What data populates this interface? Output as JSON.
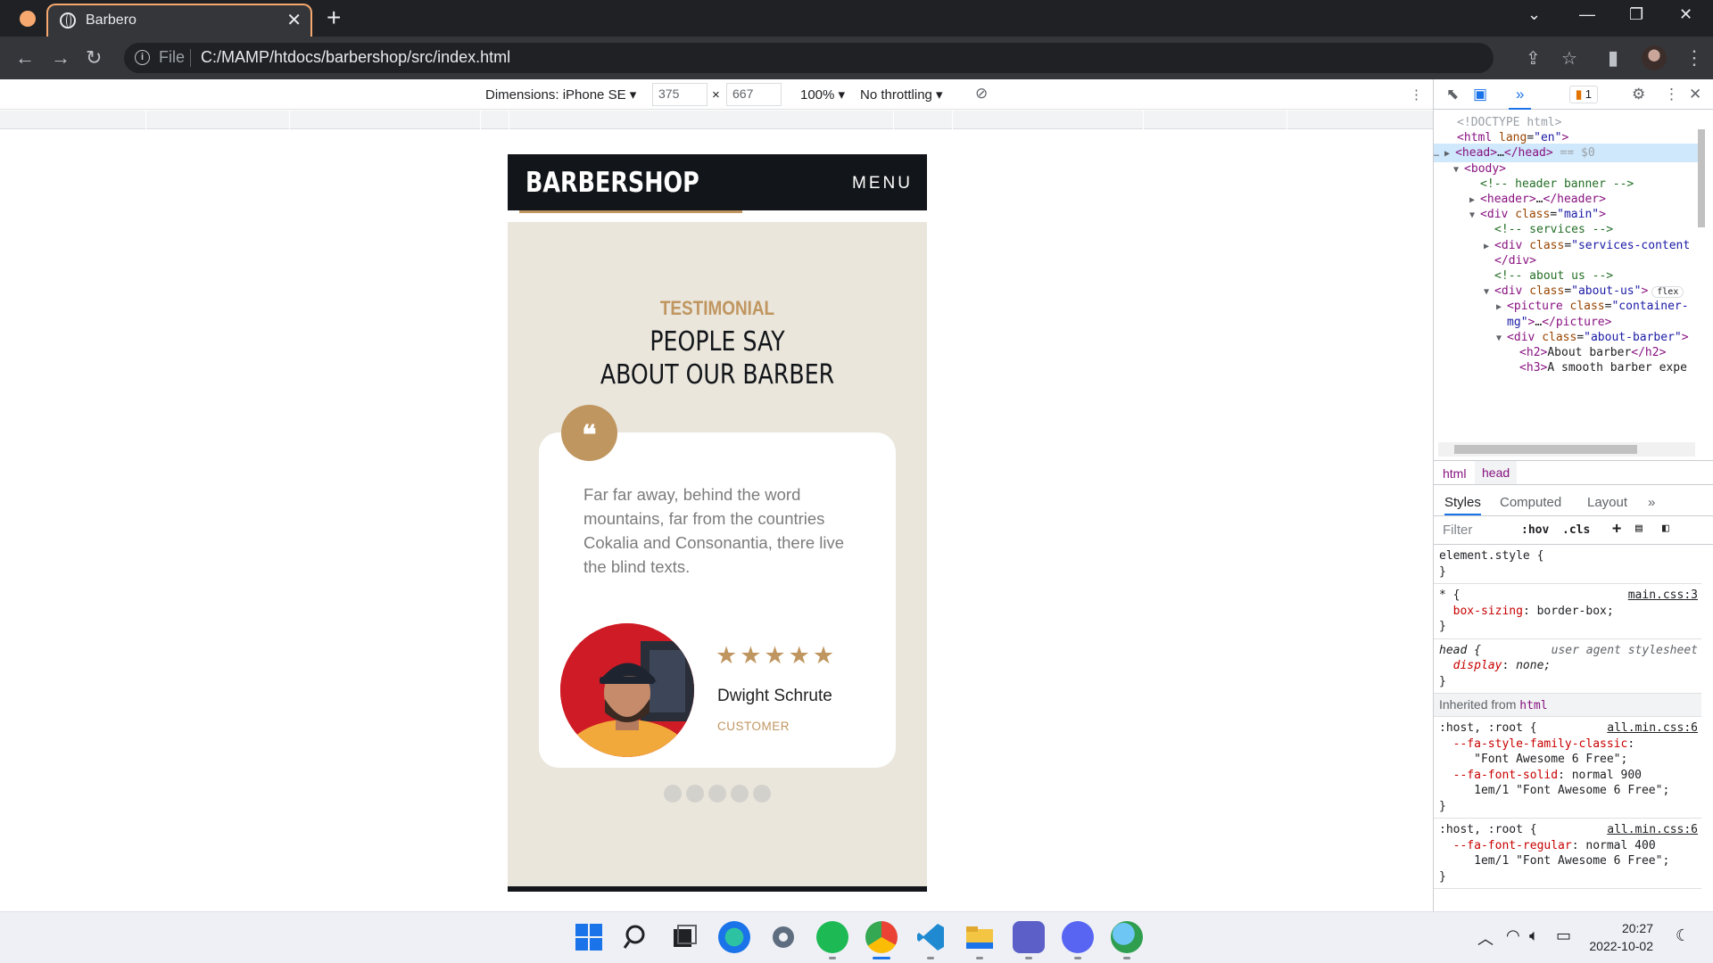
{
  "browser": {
    "tab_title": "Barbero",
    "file_label": "File",
    "url": "C:/MAMP/htdocs/barbershop/src/index.html"
  },
  "device_toolbar": {
    "dimensions_label": "Dimensions: iPhone SE",
    "width": "375",
    "times": "×",
    "height": "667",
    "zoom": "100%",
    "throttling": "No throttling"
  },
  "site": {
    "logo": "BARBERSHOP",
    "menu": "MENU",
    "eyebrow": "TESTIMONIAL",
    "heading_line1": "PEOPLE SAY",
    "heading_line2": "ABOUT OUR BARBER",
    "quote_mark": "❝",
    "quote": "Far far away, behind the word mountains, far from the countries Cokalia and Consonantia, there live the blind texts.",
    "stars": "★★★★★",
    "rating": 5,
    "customer_name": "Dwight Schrute",
    "customer_role": "CUSTOMER",
    "dots": 5
  },
  "devtools": {
    "warning_count": "1",
    "elements": [
      {
        "html": "<span class='gray'>&lt;!DOCTYPE html&gt;</span>"
      },
      {
        "html": "<span class='tag'>&lt;html</span> <span class='attr'>lang</span>=<span class='val'>\"en\"</span><span class='tag'>&gt;</span>"
      },
      {
        "html": "<span class='tag'>&lt;head&gt;</span>…<span class='tag'>&lt;/head&gt;</span> <span class='gray'>== $0</span>"
      },
      {
        "html": "<span class='tag'>&lt;body&gt;</span>"
      },
      {
        "html": "<span class='cmt'>&lt;!-- header banner --&gt;</span>"
      },
      {
        "html": "<span class='tag'>&lt;header&gt;</span>…<span class='tag'>&lt;/header&gt;</span>"
      },
      {
        "html": "<span class='tag'>&lt;div</span> <span class='attr'>class</span>=<span class='val'>\"main\"</span><span class='tag'>&gt;</span>"
      },
      {
        "html": "<span class='cmt'>&lt;!-- services --&gt;</span>"
      },
      {
        "html": "<span class='tag'>&lt;div</span> <span class='attr'>class</span>=<span class='val'>\"services-content</span>"
      },
      {
        "html": "<span class='tag'>&lt;/div&gt;</span>"
      },
      {
        "html": "<span class='cmt'>&lt;!-- about us --&gt;</span>"
      },
      {
        "html": "<span class='tag'>&lt;div</span> <span class='attr'>class</span>=<span class='val'>\"about-us\"</span><span class='tag'>&gt;</span>"
      },
      {
        "html": "<span class='tag'>&lt;picture</span> <span class='attr'>class</span>=<span class='val'>\"container-</span>"
      },
      {
        "html": "<span class='val'>mg\"</span><span class='tag'>&gt;</span>…<span class='tag'>&lt;/picture&gt;</span>"
      },
      {
        "html": "<span class='tag'>&lt;div</span> <span class='attr'>class</span>=<span class='val'>\"about-barber\"</span><span class='tag'>&gt;</span>"
      },
      {
        "html": "<span class='tag'>&lt;h2&gt;</span>About barber<span class='tag'>&lt;/h2&gt;</span>"
      },
      {
        "html": "<span class='tag'>&lt;h3&gt;</span>A smooth barber expe"
      }
    ],
    "flex_badge": "flex",
    "breadcrumb_html": "html",
    "breadcrumb_head": "head",
    "tab_styles": "Styles",
    "tab_computed": "Computed",
    "tab_layout": "Layout",
    "filter_placeholder": "Filter",
    "hov": ":hov",
    "cls": ".cls",
    "element_style": "element.style {",
    "close_brace": "}",
    "star_selector": "* {",
    "star_source": "main.css:3",
    "star_prop": "box-sizing",
    "star_value": "border-box;",
    "head_selector": "head {",
    "head_source": "user agent stylesheet",
    "head_prop": "display",
    "head_value": "none;",
    "inherited_label": "Inherited from",
    "inherited_tag": "html",
    "root_selector": ":host, :root {",
    "root_source": "all.min.css:6",
    "fa_classic_prop": "--fa-style-family-classic",
    "fa_classic_value": "\"Font Awesome 6 Free\";",
    "fa_solid_prop": "--fa-font-solid",
    "fa_solid_value1": "normal 900",
    "fa_solid_value2": "1em/1 \"Font Awesome 6 Free\";",
    "fa_regular_prop": "--fa-font-regular",
    "fa_regular_value1": "normal 400",
    "fa_regular_value2": "1em/1 \"Font Awesome 6 Free\";"
  },
  "taskbar": {
    "time": "20:27",
    "date": "2022-10-02"
  },
  "colors": {
    "accent_gold": "#c09660",
    "site_dark": "#121519",
    "section_bg": "#eae6dc"
  }
}
